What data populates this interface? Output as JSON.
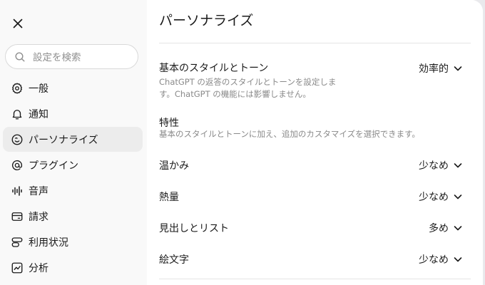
{
  "sidebar": {
    "search_placeholder": "設定を検索",
    "items": [
      {
        "label": "一般",
        "icon": "gear-icon"
      },
      {
        "label": "通知",
        "icon": "bell-icon"
      },
      {
        "label": "パーソナライズ",
        "icon": "personalize-icon",
        "active": true
      },
      {
        "label": "プラグイン",
        "icon": "at-sign-icon"
      },
      {
        "label": "音声",
        "icon": "audio-wave-icon"
      },
      {
        "label": "請求",
        "icon": "credit-card-icon"
      },
      {
        "label": "利用状況",
        "icon": "usage-icon"
      },
      {
        "label": "分析",
        "icon": "chart-icon"
      }
    ]
  },
  "main": {
    "title": "パーソナライズ",
    "style_tone": {
      "label": "基本のスタイルとトーン",
      "description_line1": "ChatGPT の返答のスタイルとトーンを設定しま",
      "description_line2": "す。ChatGPT の機能には影響しません。",
      "value": "効率的"
    },
    "traits": {
      "label": "特性",
      "description": "基本のスタイルとトーンに加え、追加のカスタマイズを選択できます。"
    },
    "settings": [
      {
        "label": "温かみ",
        "value": "少なめ"
      },
      {
        "label": "熱量",
        "value": "少なめ"
      },
      {
        "label": "見出しとリスト",
        "value": "多め"
      },
      {
        "label": "絵文字",
        "value": "少なめ"
      }
    ]
  }
}
